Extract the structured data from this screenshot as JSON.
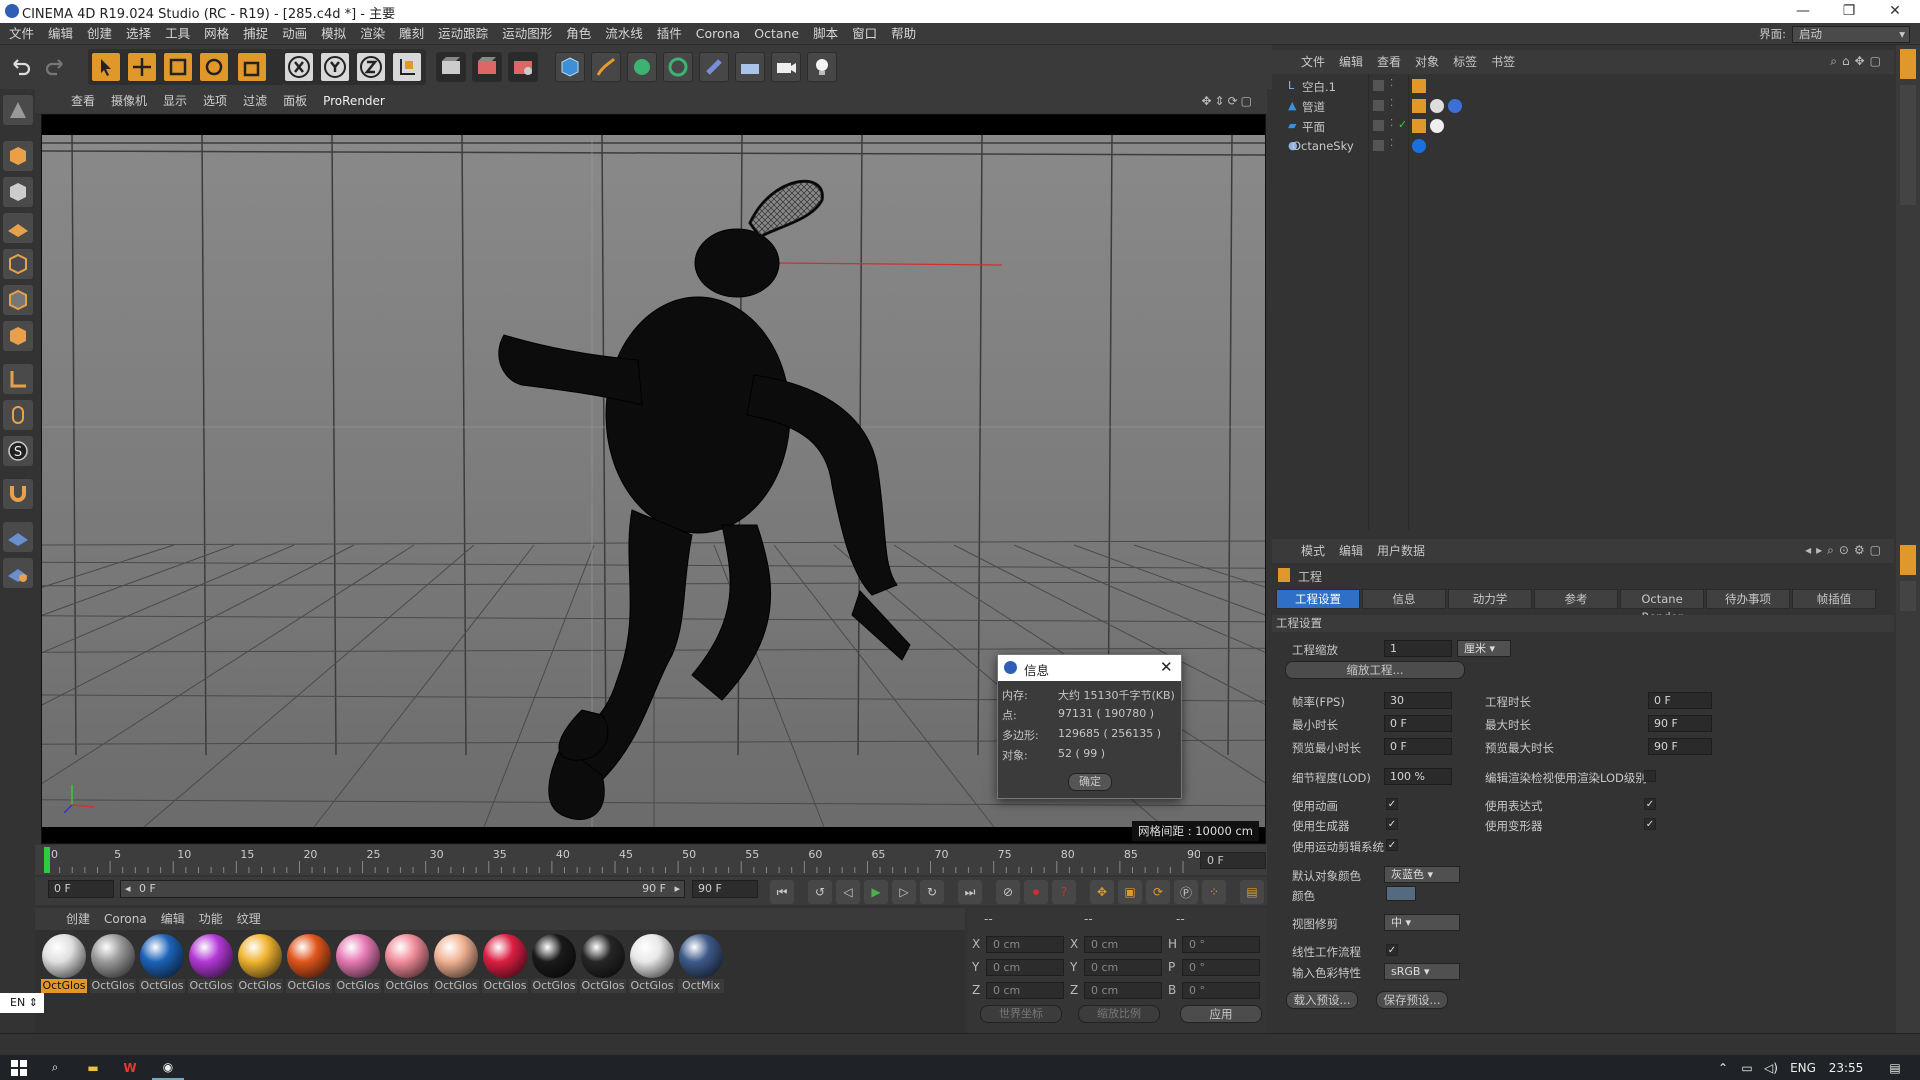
{
  "window": {
    "title": "CINEMA 4D R19.024 Studio (RC - R19) - [285.c4d *] - 主要"
  },
  "menu": [
    "文件",
    "编辑",
    "创建",
    "选择",
    "工具",
    "网格",
    "捕捉",
    "动画",
    "模拟",
    "渲染",
    "雕刻",
    "运动跟踪",
    "运动图形",
    "角色",
    "流水线",
    "插件",
    "Corona",
    "Octane",
    "脚本",
    "窗口",
    "帮助"
  ],
  "interface": {
    "label": "界面:",
    "value": "启动"
  },
  "viewport": {
    "menu": [
      "查看",
      "摄像机",
      "显示",
      "选项",
      "过滤",
      "面板",
      "ProRender"
    ],
    "grid_text": "网格间距 : 10000 cm"
  },
  "timeline": {
    "ticks": [
      "0",
      "5",
      "10",
      "15",
      "20",
      "25",
      "30",
      "35",
      "40",
      "45",
      "50",
      "55",
      "60",
      "65",
      "70",
      "75",
      "80",
      "85",
      "90"
    ],
    "current": "0 F"
  },
  "transport": {
    "start": "0 F",
    "range_start": "0 F",
    "range_end": "90 F",
    "end": "90 F"
  },
  "materials": {
    "menu": [
      "创建",
      "Corona",
      "编辑",
      "功能",
      "纹理"
    ],
    "items": [
      {
        "name": "OctGlos",
        "color": "#e0e0e0"
      },
      {
        "name": "OctGlos",
        "color": "#9a9a9a"
      },
      {
        "name": "OctGlos",
        "color": "#1d63b8"
      },
      {
        "name": "OctGlos",
        "color": "#b339d6"
      },
      {
        "name": "OctGlos",
        "color": "#f0b431"
      },
      {
        "name": "OctGlos",
        "color": "#e0561d"
      },
      {
        "name": "OctGlos",
        "color": "#e67ab4"
      },
      {
        "name": "OctGlos",
        "color": "#f28c9b"
      },
      {
        "name": "OctGlos",
        "color": "#f2b293"
      },
      {
        "name": "OctGlos",
        "color": "#dc1f43"
      },
      {
        "name": "OctGlos",
        "color": "#1a1a1a"
      },
      {
        "name": "OctGlos",
        "color": "#262626"
      },
      {
        "name": "OctGlos",
        "color": "#e8e8e8"
      },
      {
        "name": "OctMix",
        "color": "#3d5a8a"
      }
    ]
  },
  "coords": {
    "rows": [
      {
        "a": "X",
        "av": "0 cm",
        "b": "X",
        "bv": "0 cm",
        "c": "H",
        "cv": "0 °"
      },
      {
        "a": "Y",
        "av": "0 cm",
        "b": "Y",
        "bv": "0 cm",
        "c": "P",
        "cv": "0 °"
      },
      {
        "a": "Z",
        "av": "0 cm",
        "b": "Z",
        "bv": "0 cm",
        "c": "B",
        "cv": "0 °"
      }
    ],
    "dashes": "--",
    "world": "世界坐标",
    "scale": "缩放比例",
    "apply": "应用"
  },
  "objects": {
    "menu": [
      "文件",
      "编辑",
      "查看",
      "对象",
      "标签",
      "书签"
    ],
    "items": [
      {
        "name": "空白.1"
      },
      {
        "name": "管道"
      },
      {
        "name": "平面"
      },
      {
        "name": "OctaneSky"
      }
    ]
  },
  "attributes": {
    "menu": [
      "模式",
      "编辑",
      "用户数据"
    ],
    "title": "工程",
    "tabs": [
      "工程设置",
      "信息",
      "动力学",
      "参考",
      "Octane Render",
      "待办事项",
      "帧插值"
    ],
    "section": "工程设置",
    "scale_label": "工程缩放",
    "scale_value": "1",
    "scale_unit": "厘米",
    "scale_btn": "缩放工程...",
    "fps_label": "帧率(FPS)",
    "fps": "30",
    "time_label": "工程时长",
    "time": "0 F",
    "min_label": "最小时长",
    "min": "0 F",
    "max_label": "最大时长",
    "max": "90 F",
    "pmin_label": "预览最小时长",
    "pmin": "0 F",
    "pmax_label": "预览最大时长",
    "pmax": "90 F",
    "lod_label": "细节程度(LOD)",
    "lod": "100 %",
    "lod_render": "编辑渲染检视使用渲染LOD级别",
    "anim_label": "使用动画",
    "expr_label": "使用表达式",
    "gen_label": "使用生成器",
    "deform_label": "使用变形器",
    "mograph_label": "使用运动剪辑系统",
    "objcolor_label": "默认对象颜色",
    "objcolor": "灰蓝色",
    "color_label": "颜色",
    "clip_label": "视图修剪",
    "clip": "中",
    "linear_label": "线性工作流程",
    "profile_label": "输入色彩特性",
    "profile": "sRGB",
    "load_btn": "载入预设...",
    "save_btn": "保存预设..."
  },
  "dialog": {
    "title": "信息",
    "rows": [
      {
        "k": "内存:",
        "v": "大约 15130千字节(KB)"
      },
      {
        "k": "点:",
        "v": "97131 ( 190780 )"
      },
      {
        "k": "多边形:",
        "v": "129685 ( 256135 )"
      },
      {
        "k": "对象:",
        "v": "52 ( 99 )"
      }
    ],
    "ok": "确定"
  },
  "lang": "EN",
  "taskbar": {
    "lang": "ENG",
    "time": "23:55"
  },
  "colors": {
    "accent": "#2e7bd6",
    "play": "#4caf50",
    "record": "#d32f2f",
    "timeline_marker": "#2ecc40"
  }
}
